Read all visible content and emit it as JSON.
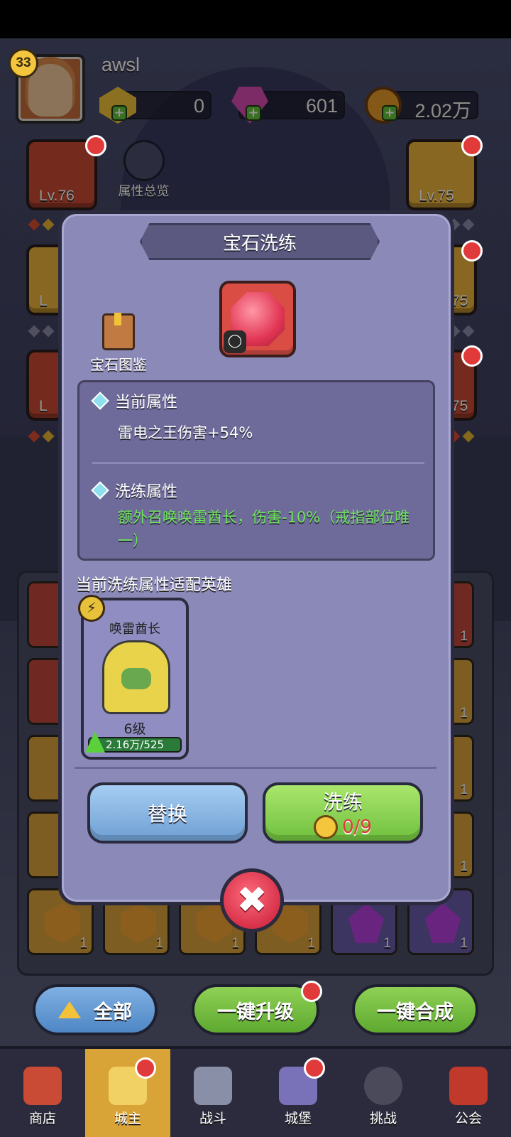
{
  "player": {
    "level": "33",
    "name": "awsl"
  },
  "currencies": [
    {
      "icon": "gold-gem-icon",
      "value": "0"
    },
    {
      "icon": "pink-crystal-icon",
      "value": "601"
    },
    {
      "icon": "coin-icon",
      "value": "2.02万"
    }
  ],
  "side_tiles": {
    "left_top_level": "Lv.76",
    "right_top_level": "Lv.75",
    "right_mid_level": "75",
    "right_low_level": "75",
    "left_mid_level": "L",
    "left_low_level": "L"
  },
  "attribute_overview": "属性总览",
  "modal": {
    "title": "宝石洗练",
    "gem_book_label": "宝石图鉴",
    "current_attr_label": "当前属性",
    "current_attr_value": "雷电之王伤害+54%",
    "refine_attr_label": "洗练属性",
    "refine_attr_value": "额外召唤唤雷酋长，伤害-10%（戒指部位唯一）",
    "fit_heroes_label": "当前洗练属性适配英雄",
    "hero": {
      "name": "唤雷酋长",
      "level": "6级",
      "progress": "2.16万/525"
    },
    "replace_button": "替换",
    "refine_button": "洗练",
    "refine_cost": "0/9",
    "close_symbol": "✖"
  },
  "inventory_counts": [
    "1",
    "1",
    "1",
    "1",
    "1",
    "1",
    "1",
    "1",
    "1",
    "1"
  ],
  "bottom_buttons": {
    "all": "全部",
    "one_click_upgrade": "一键升级",
    "one_click_merge": "一键合成"
  },
  "nav": [
    {
      "label": "商店",
      "icon": "shop-icon"
    },
    {
      "label": "城主",
      "icon": "crown-icon"
    },
    {
      "label": "战斗",
      "icon": "swords-icon"
    },
    {
      "label": "城堡",
      "icon": "castle-icon"
    },
    {
      "label": "挑战",
      "icon": "demon-icon"
    },
    {
      "label": "公会",
      "icon": "banner-icon"
    }
  ],
  "colors": {
    "modal_bg": "#8b89b8",
    "refine_text": "#6ee35c",
    "replace_btn": "#8bb8e8",
    "refine_btn": "#8ed555",
    "close_btn": "#e23a4f",
    "nav_active": "#d9a437"
  }
}
